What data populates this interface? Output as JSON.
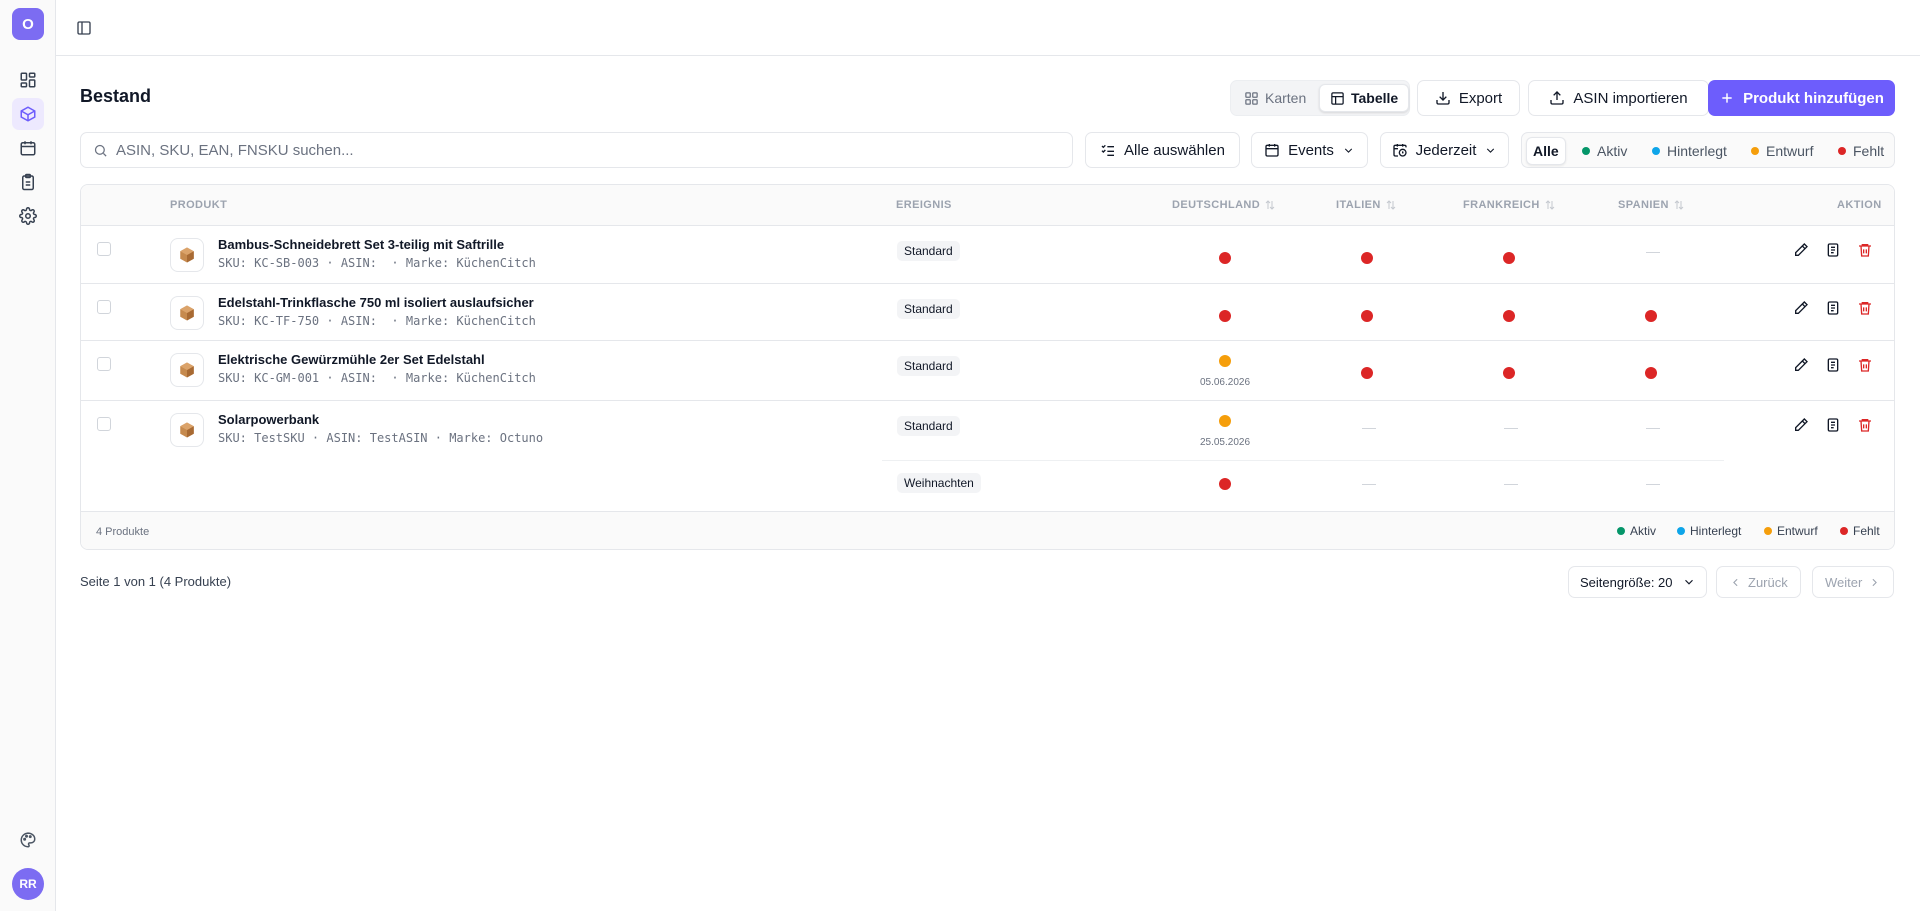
{
  "colors": {
    "accent": "#6d5dfc",
    "aktiv": "#059669",
    "hinterlegt": "#0ea5e9",
    "entwurf": "#f59e0b",
    "fehlt": "#dc2626"
  },
  "sidebar": {
    "logo": "O",
    "items": [
      {
        "icon": "dashboard-icon"
      },
      {
        "icon": "package-icon",
        "active": true
      },
      {
        "icon": "calendar-icon"
      },
      {
        "icon": "clipboard-icon"
      },
      {
        "icon": "gear-icon"
      }
    ],
    "user_initials": "RR"
  },
  "header": {
    "title": "Bestand",
    "view_cards": "Karten",
    "view_table": "Tabelle",
    "export": "Export",
    "import": "ASIN importieren",
    "add_product": "Produkt hinzufügen"
  },
  "filters": {
    "search_placeholder": "ASIN, SKU, EAN, FNSKU suchen...",
    "select_all": "Alle auswählen",
    "events": "Events",
    "time": "Jederzeit",
    "status_all": "Alle",
    "status_aktiv": "Aktiv",
    "status_hinterlegt": "Hinterlegt",
    "status_entwurf": "Entwurf",
    "status_fehlt": "Fehlt"
  },
  "table": {
    "columns": {
      "product": "PRODUKT",
      "event": "EREIGNIS",
      "de": "DEUTSCHLAND",
      "it": "ITALIEN",
      "fr": "FRANKREICH",
      "es": "SPANIEN",
      "action": "AKTION"
    },
    "rows": [
      {
        "name": "Bambus-Schneidebrett Set 3-teilig mit Saftrille",
        "meta": "SKU: KC-SB-003 · ASIN:  · Marke: KüchenCitch",
        "entries": [
          {
            "event": "Standard",
            "de": "fehlt",
            "it": "fehlt",
            "fr": "fehlt",
            "es": "none"
          }
        ]
      },
      {
        "name": "Edelstahl-Trinkflasche 750 ml isoliert auslaufsicher",
        "meta": "SKU: KC-TF-750 · ASIN:  · Marke: KüchenCitch",
        "entries": [
          {
            "event": "Standard",
            "de": "fehlt",
            "it": "fehlt",
            "fr": "fehlt",
            "es": "fehlt"
          }
        ]
      },
      {
        "name": "Elektrische Gewürzmühle 2er Set Edelstahl",
        "meta": "SKU: KC-GM-001 · ASIN:  · Marke: KüchenCitch",
        "entries": [
          {
            "event": "Standard",
            "de": "entwurf",
            "de_date": "05.06.2026",
            "it": "fehlt",
            "fr": "fehlt",
            "es": "fehlt"
          }
        ]
      },
      {
        "name": "Solarpowerbank",
        "meta": "SKU: TestSKU · ASIN: TestASIN · Marke: Octuno",
        "entries": [
          {
            "event": "Standard",
            "de": "entwurf",
            "de_date": "25.05.2026",
            "it": "none",
            "fr": "none",
            "es": "none"
          },
          {
            "event": "Weihnachten",
            "de": "fehlt",
            "it": "none",
            "fr": "none",
            "es": "none"
          }
        ]
      }
    ],
    "footer_count": "4 Produkte",
    "legend": {
      "aktiv": "Aktiv",
      "hinterlegt": "Hinterlegt",
      "entwurf": "Entwurf",
      "fehlt": "Fehlt"
    }
  },
  "pagination": {
    "info": "Seite 1 von 1 (4 Produkte)",
    "page_size": "Seitengröße: 20",
    "prev": "Zurück",
    "next": "Weiter"
  }
}
